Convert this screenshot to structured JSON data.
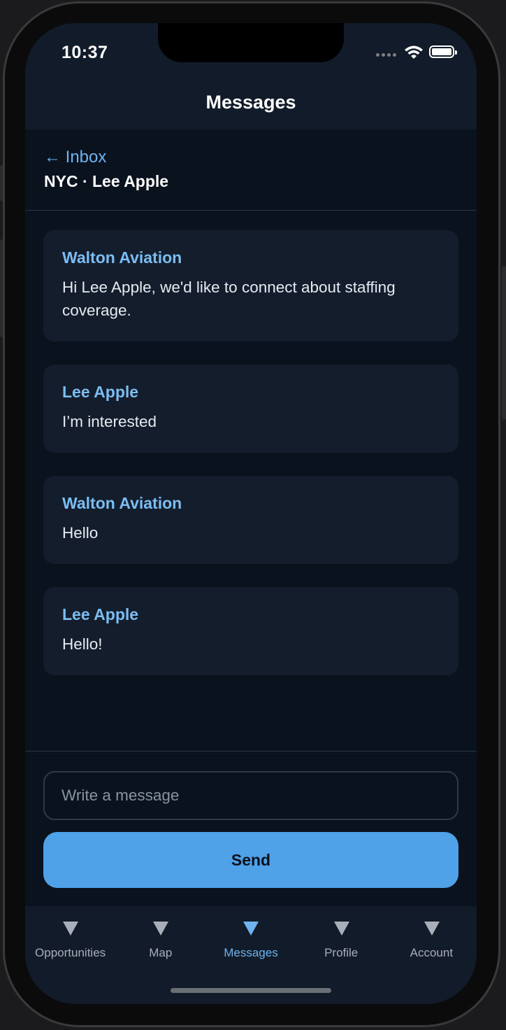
{
  "status_bar": {
    "time": "10:37"
  },
  "header": {
    "title": "Messages"
  },
  "thread": {
    "back_label": "← Inbox",
    "title": "NYC · Lee Apple"
  },
  "messages": [
    {
      "sender": "Walton Aviation",
      "text": "Hi Lee Apple, we'd like to connect about staffing coverage."
    },
    {
      "sender": "Lee Apple",
      "text": "I’m interested"
    },
    {
      "sender": "Walton Aviation",
      "text": "Hello"
    },
    {
      "sender": "Lee Apple",
      "text": "Hello!"
    }
  ],
  "compose": {
    "placeholder": "Write a message",
    "value": "",
    "send_label": "Send"
  },
  "tabs": [
    {
      "label": "Opportunities",
      "icon": "triangle-down-icon",
      "active": false
    },
    {
      "label": "Map",
      "icon": "triangle-down-icon",
      "active": false
    },
    {
      "label": "Messages",
      "icon": "triangle-down-icon",
      "active": true
    },
    {
      "label": "Profile",
      "icon": "triangle-down-icon",
      "active": false
    },
    {
      "label": "Account",
      "icon": "triangle-down-icon",
      "active": false
    }
  ],
  "colors": {
    "accent": "#4fa1e8",
    "link": "#6fb3ee",
    "background": "#0a121e",
    "surface": "#131d2c",
    "bar": "#111b29"
  }
}
